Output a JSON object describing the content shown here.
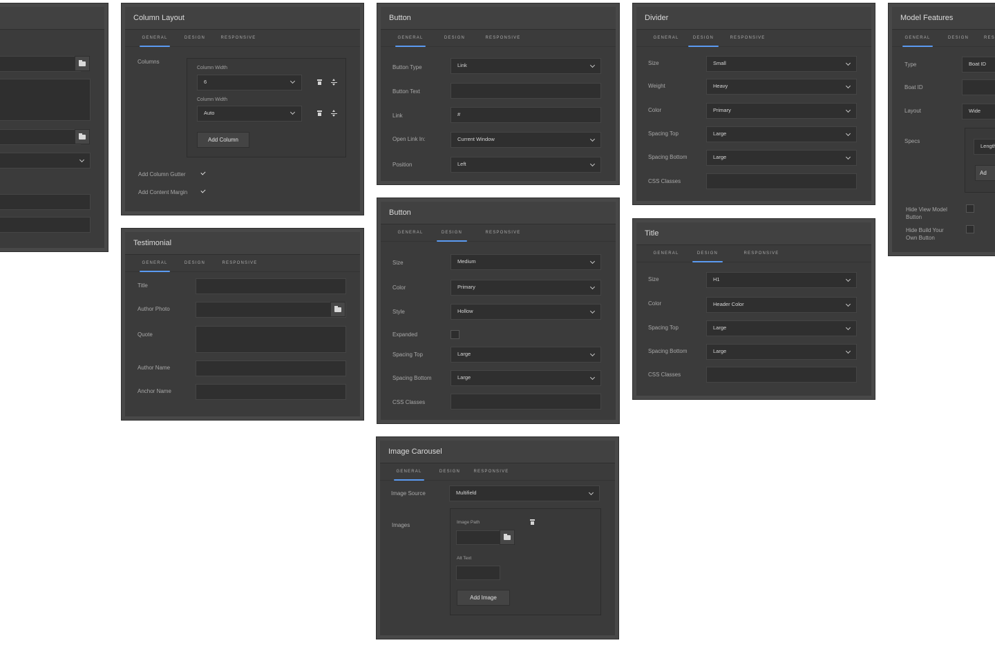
{
  "tabs": {
    "general": "GENERAL",
    "design": "DESIGN",
    "responsive": "RESPONSIVE"
  },
  "accent_color": "#5b9bf2",
  "column_layout": {
    "title": "Column Layout",
    "columns_label": "Columns",
    "column_width_label": "Column Width",
    "column1_width": "6",
    "column2_width": "Auto",
    "add_column": "Add Column",
    "add_column_gutter": "Add Column Gutter",
    "add_content_margin": "Add Content Margin",
    "gutter_checked": true,
    "margin_checked": true
  },
  "testimonial": {
    "title": "Testimonial",
    "fields": {
      "title": "Title",
      "author_photo": "Author Photo",
      "quote": "Quote",
      "author_name": "Author Name",
      "anchor_name": "Anchor Name"
    }
  },
  "button_general": {
    "title": "Button",
    "button_type_label": "Button Type",
    "button_type": "Link",
    "button_text_label": "Button Text",
    "link_label": "Link",
    "link_value": "#",
    "open_link_label": "Open Link In:",
    "open_link_value": "Current Window",
    "position_label": "Position",
    "position_value": "Left"
  },
  "button_design": {
    "title": "Button",
    "size_label": "Size",
    "size_value": "Medium",
    "color_label": "Color",
    "color_value": "Primary",
    "style_label": "Style",
    "style_value": "Hollow",
    "expanded_label": "Expanded",
    "spacing_top_label": "Spacing Top",
    "spacing_top_value": "Large",
    "spacing_bottom_label": "Spacing Bottom",
    "spacing_bottom_value": "Large",
    "css_label": "CSS Classes"
  },
  "image_carousel": {
    "title": "Image Carousel",
    "image_source_label": "Image Source",
    "image_source_value": "Multifield",
    "images_label": "Images",
    "image_path_label": "Image Path",
    "alt_text_label": "Alt Text",
    "add_image": "Add Image"
  },
  "divider": {
    "title": "Divider",
    "size_label": "Size",
    "size_value": "Small",
    "weight_label": "Weight",
    "weight_value": "Heavy",
    "color_label": "Color",
    "color_value": "Primary",
    "spacing_top_label": "Spacing Top",
    "spacing_top_value": "Large",
    "spacing_bottom_label": "Spacing Bottom",
    "spacing_bottom_value": "Large",
    "css_label": "CSS Classes"
  },
  "title_panel": {
    "title": "Title",
    "size_label": "Size",
    "size_value": "H1",
    "color_label": "Color",
    "color_value": "Header Color",
    "spacing_top_label": "Spacing Top",
    "spacing_top_value": "Large",
    "spacing_bottom_label": "Spacing Bottom",
    "spacing_bottom_value": "Large",
    "css_label": "CSS Classes"
  },
  "model_features": {
    "title": "Model Features",
    "tab_responsive_partial": "RES",
    "type_label": "Type",
    "type_value": "Boat ID",
    "boat_id_label": "Boat ID",
    "layout_label": "Layout",
    "layout_value": "Wide",
    "specs_label": "Specs",
    "specs_partial": "Length",
    "add_partial": "Ad",
    "hide_view_model": "Hide View Model Button",
    "hide_build_your_own": "Hide Build Your Own Button"
  }
}
